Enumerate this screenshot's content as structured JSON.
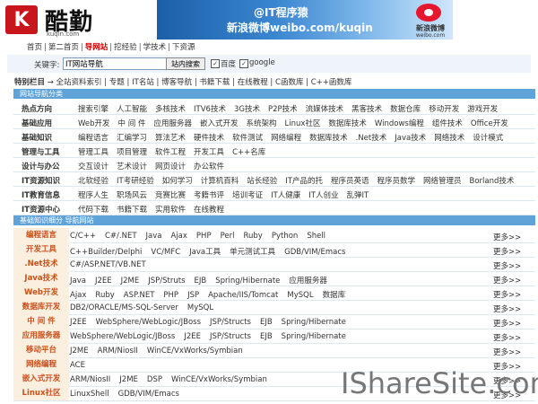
{
  "header": {
    "logo_char": "K",
    "logo_text": "酷勤",
    "logo_url": "kuqin.com",
    "banner_line1": "@IT程序猿",
    "banner_line2": "新浪微博weibo.com/kuqin",
    "weibo_name": "新浪微博",
    "weibo_url": "weibo.com"
  },
  "topnav": [
    "首页",
    "第二首页",
    "导网站",
    "挖经验",
    "学技术",
    "下资源"
  ],
  "topnav_active": 2,
  "search": {
    "label": "关键字:",
    "value": "IT网站导航",
    "button": "站内搜索",
    "opt1": "百度",
    "opt2": "google"
  },
  "special": {
    "label": "特别栏目",
    "items": [
      "全站资料索引",
      "专题",
      "IT名站",
      "博客导航",
      "书籍下载",
      "在线教程",
      "C函数库",
      "C++函数库"
    ]
  },
  "section1": "网站导航分类",
  "categories": [
    {
      "name": "热点方向",
      "links": [
        "搜索引擎",
        "人工智能",
        "多核技术",
        "ITV6技术",
        "3G技术",
        "P2P技术",
        "流媒体技术",
        "黑客技术",
        "数据仓库",
        "移动开发",
        "游戏开发"
      ]
    },
    {
      "name": "基础应用",
      "links": [
        "Web开发",
        "中 间 件",
        "应用服务器",
        "嵌入式开发",
        "系统架构",
        "Linux社区",
        "数据库技术",
        "Windows编程",
        "组件技术",
        "Office开发"
      ]
    },
    {
      "name": "基础知识",
      "links": [
        "编程语言",
        "汇编学习",
        "算法艺术",
        "硬件技术",
        "软件测试",
        "网络编程",
        "数据库技术",
        ".Net技术",
        "Java技术",
        "网络技术",
        "设计模式"
      ]
    },
    {
      "name": "管理与工具",
      "links": [
        "管理工具",
        "项目管理",
        "软件工程",
        "开发工具",
        "C++名库"
      ]
    },
    {
      "name": "设计与办公",
      "links": [
        "交互设计",
        "艺术设计",
        "网页设计",
        "办公软件"
      ]
    },
    {
      "name": "IT资源知识",
      "links": [
        "北软经验",
        "IT考研经验",
        "如何学习",
        "计算机百科",
        "站长经验",
        "IT产品的托",
        "程序员英语",
        "程序员数学",
        "网络管理员",
        "Borland技术"
      ]
    },
    {
      "name": "IT教育信息",
      "links": [
        "程序人生",
        "职场风云",
        "竞赛比赛",
        "考籍书评",
        "培训考证",
        "IT人健康",
        "IT人创业",
        "乱弹IT"
      ]
    },
    {
      "name": "IT资源中心",
      "links": [
        "代码下载",
        "书籍下载",
        "实用软件",
        "在线教程"
      ]
    }
  ],
  "section2": "基础知识细分 导航网站",
  "languages": [
    {
      "name": "编程语言",
      "links": [
        "C/C++",
        "C#/.NET",
        "Java",
        "Ajax",
        "PHP",
        "Perl",
        "Ruby",
        "Python",
        "Shell"
      ]
    },
    {
      "name": "开发工具",
      "links": [
        "C++Builder/Delphi",
        "VC/MFC",
        "Java工具",
        "单元测试工具",
        "GDB/VIM/Emacs"
      ]
    },
    {
      "name": ".Net技术",
      "links": [
        "C#/ASP.NET/VB.NET"
      ]
    },
    {
      "name": "Java技术",
      "links": [
        "Java",
        "J2EE",
        "J2ME",
        "JSP/Struts",
        "EJB",
        "Spring/Hibernate",
        "应用服务器"
      ]
    },
    {
      "name": "Web开发",
      "links": [
        "Ajax",
        "Ruby",
        "ASP.NET",
        "PHP",
        "JSP",
        "Apache/IIS/Tomcat",
        "MySQL",
        "数据库"
      ]
    },
    {
      "name": "数据库开发",
      "links": [
        "DB2/ORACLE/MS-SQL-Server",
        "MySQL"
      ]
    },
    {
      "name": "中 间 件",
      "links": [
        "J2EE",
        "WebSphere/WebLogic/JBoss",
        "JSP/Structs",
        "EJB",
        "Spring/Hibernate"
      ]
    },
    {
      "name": "应用服务器",
      "links": [
        "WebSphere/WebLogic/JBoss",
        "J2EE",
        "JSP/Structs",
        "EJB",
        "Spring/Hibernate"
      ]
    },
    {
      "name": "移动平台",
      "links": [
        "J2ME",
        "ARM/NiosII",
        "WinCE/VxWorks/Symbian"
      ]
    },
    {
      "name": "网络编程",
      "links": [
        "ACE"
      ]
    },
    {
      "name": "嵌入式开发",
      "links": [
        "ARM/NiosII",
        "J2ME",
        "DSP",
        "WinCE/VxWorks/Symbian"
      ]
    },
    {
      "name": "Linux社区",
      "links": [
        "LinuxShell",
        "GDB/VIM/Emacs"
      ]
    }
  ],
  "more_label": "更多>>",
  "watermark": "IShareSite.com"
}
